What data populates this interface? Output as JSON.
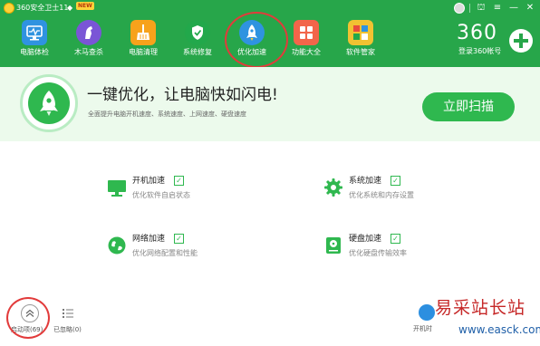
{
  "app": {
    "title": "360安全卫士11",
    "badge": "NEW"
  },
  "window_controls": {
    "user": "user-avatar-icon",
    "skin": "⛫",
    "menu": "≡",
    "minimize": "—",
    "close": "✕"
  },
  "nav": {
    "items": [
      {
        "label": "电脑体检",
        "icon": "monitor-checkup-icon",
        "color": "#2f93e0"
      },
      {
        "label": "木马查杀",
        "icon": "horse-icon",
        "color": "#7a55d6"
      },
      {
        "label": "电脑清理",
        "icon": "broom-icon",
        "color": "#f7a21b"
      },
      {
        "label": "系统修复",
        "icon": "shield-icon",
        "color": "#22a84b"
      },
      {
        "label": "优化加速",
        "icon": "rocket-icon",
        "color": "#2f93e0"
      },
      {
        "label": "功能大全",
        "icon": "grid-icon",
        "color": "#f2654a"
      },
      {
        "label": "软件管家",
        "icon": "software-icon",
        "color": "#f1c232"
      }
    ],
    "brand": "360",
    "login": "登录360帐号"
  },
  "banner": {
    "title": "一键优化，让电脑快如闪电!",
    "subtitle": "全面提升电脑开机速度、系统速度、上网速度、硬盘速度",
    "scan_button": "立即扫描"
  },
  "features": [
    {
      "title": "开机加速",
      "desc": "优化软件自启状态",
      "icon": "monitor-icon",
      "checked": true
    },
    {
      "title": "系统加速",
      "desc": "优化系统和内存设置",
      "icon": "gear-icon",
      "checked": true
    },
    {
      "title": "网络加速",
      "desc": "优化网络配置和性能",
      "icon": "globe-icon",
      "checked": true
    },
    {
      "title": "硬盘加速",
      "desc": "优化硬盘传输效率",
      "icon": "harddisk-icon",
      "checked": true
    }
  ],
  "bottom": {
    "startup_label": "启动项(69)",
    "ignored_label": "已忽略(0)",
    "boot_label": "开机时"
  },
  "watermark": {
    "text": "易采站长站",
    "url": "www.easck.com"
  },
  "colors": {
    "header_green": "#27a64a",
    "accent_green": "#2fb84f",
    "banner_bg": "#ecfaec",
    "annotation_red": "#e23b3b"
  }
}
